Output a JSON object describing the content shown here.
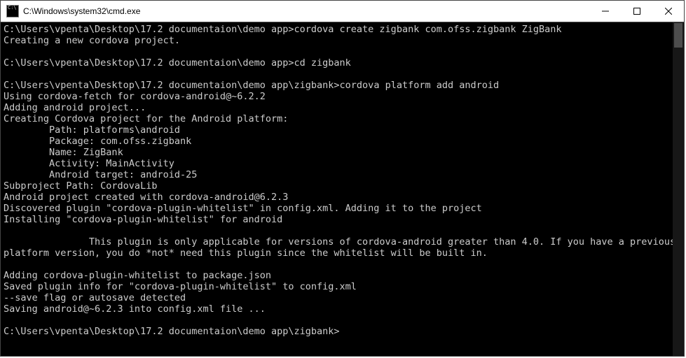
{
  "window": {
    "title": "C:\\Windows\\system32\\cmd.exe"
  },
  "prompts": {
    "p1": "C:\\Users\\vpenta\\Desktop\\17.2 documentaion\\demo app>",
    "p2": "C:\\Users\\vpenta\\Desktop\\17.2 documentaion\\demo app>",
    "p3": "C:\\Users\\vpenta\\Desktop\\17.2 documentaion\\demo app\\zigbank>",
    "p4": "C:\\Users\\vpenta\\Desktop\\17.2 documentaion\\demo app\\zigbank>"
  },
  "commands": {
    "c1": "cordova create zigbank com.ofss.zigbank ZigBank",
    "c2": "cd zigbank",
    "c3": "cordova platform add android"
  },
  "out": {
    "o1": "Creating a new cordova project.",
    "o2": "Using cordova-fetch for cordova-android@~6.2.2",
    "o3": "Adding android project...",
    "o4": "Creating Cordova project for the Android platform:",
    "o5": "        Path: platforms\\android",
    "o6": "        Package: com.ofss.zigbank",
    "o7": "        Name: ZigBank",
    "o8": "        Activity: MainActivity",
    "o9": "        Android target: android-25",
    "o10": "Subproject Path: CordovaLib",
    "o11": "Android project created with cordova-android@6.2.3",
    "o12": "Discovered plugin \"cordova-plugin-whitelist\" in config.xml. Adding it to the project",
    "o13": "Installing \"cordova-plugin-whitelist\" for android",
    "o14": "               This plugin is only applicable for versions of cordova-android greater than 4.0. If you have a previous platform version, you do *not* need this plugin since the whitelist will be built in.",
    "o15": "Adding cordova-plugin-whitelist to package.json",
    "o16": "Saved plugin info for \"cordova-plugin-whitelist\" to config.xml",
    "o17": "--save flag or autosave detected",
    "o18": "Saving android@~6.2.3 into config.xml file ..."
  }
}
